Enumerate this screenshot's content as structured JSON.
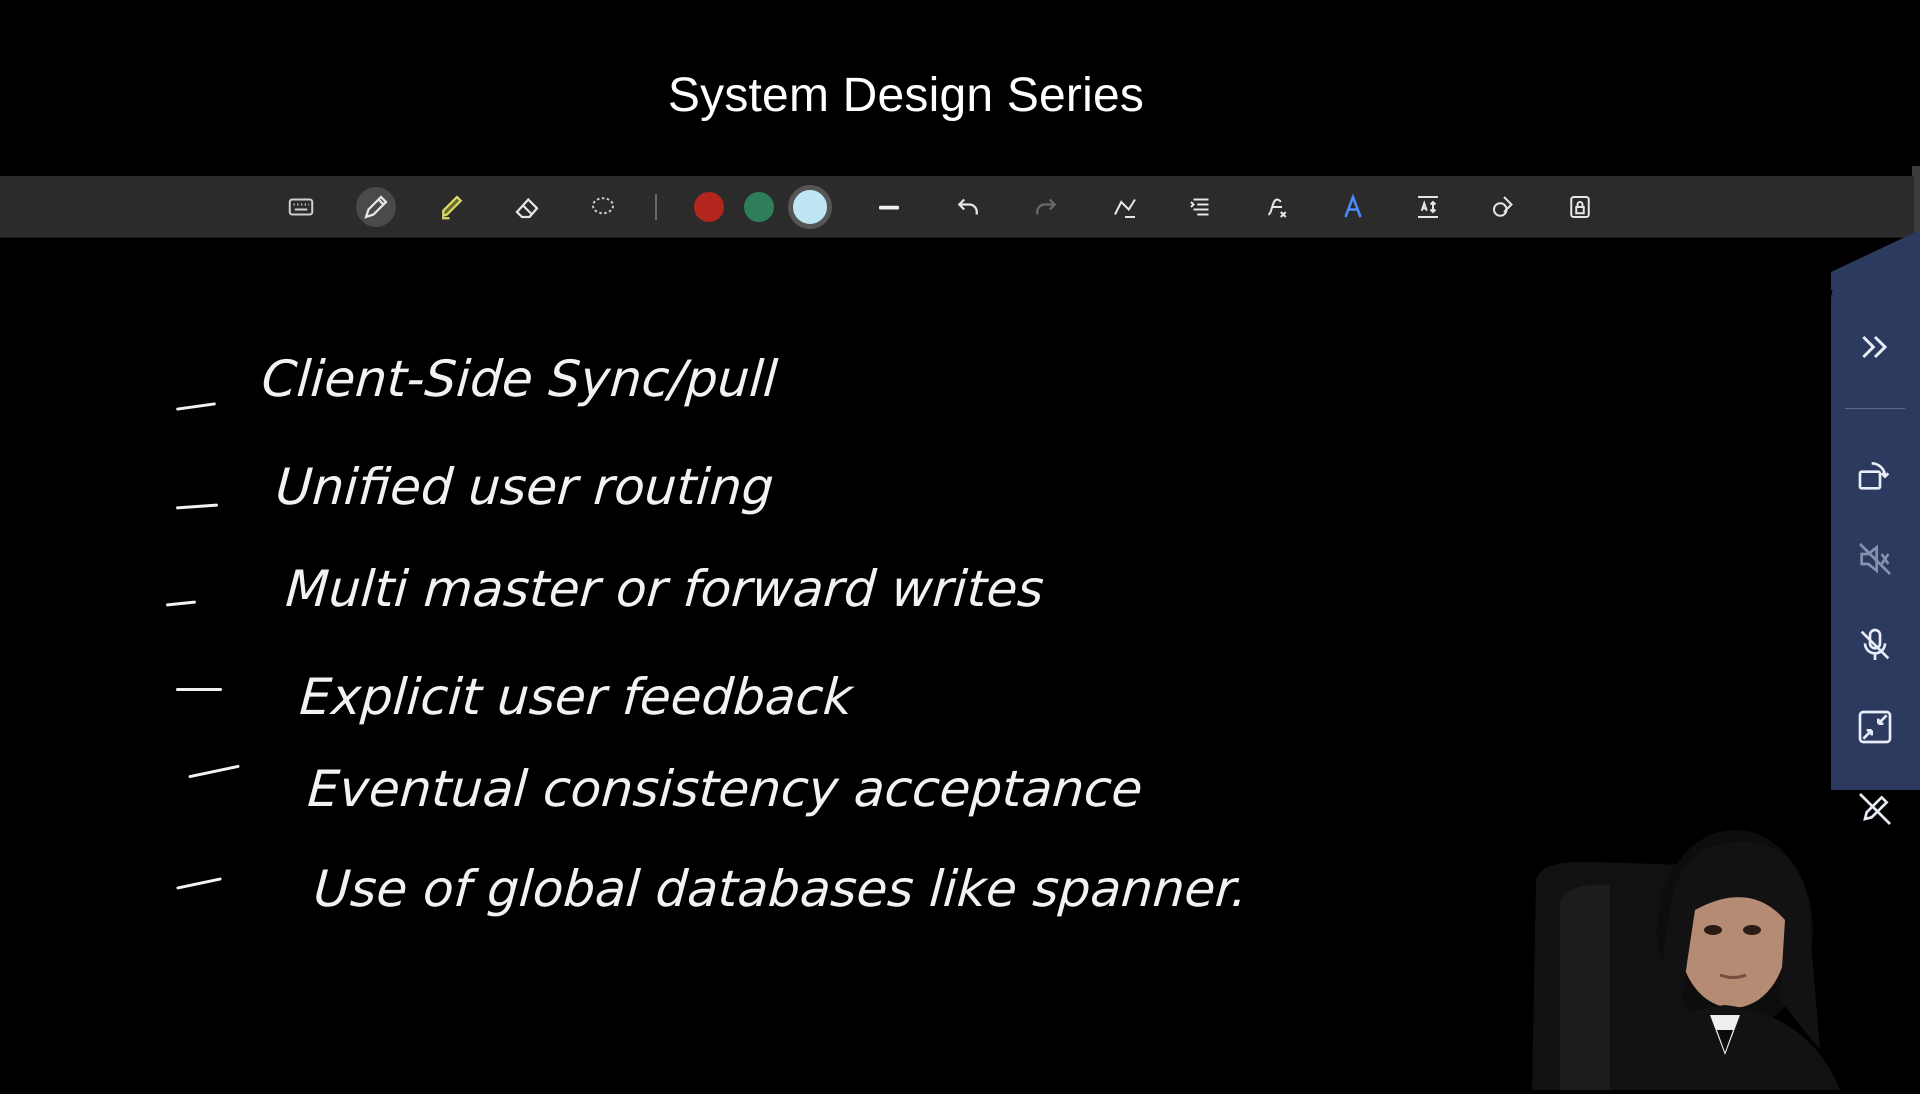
{
  "header": {
    "title": "System Design Series"
  },
  "toolbar": {
    "tools": [
      {
        "icon": "keyboard-icon"
      },
      {
        "icon": "pen-icon",
        "active": true
      },
      {
        "icon": "highlighter-icon"
      },
      {
        "icon": "eraser-icon"
      },
      {
        "icon": "lasso-select-icon"
      }
    ],
    "colors": [
      {
        "hex": "#b3261e"
      },
      {
        "hex": "#2e7d5b"
      },
      {
        "hex": "#bfe6f5",
        "selected": true
      }
    ],
    "actions": [
      {
        "icon": "stroke-width-icon"
      },
      {
        "icon": "undo-icon"
      },
      {
        "icon": "redo-icon",
        "disabled": true
      },
      {
        "icon": "ink-to-shape-icon"
      },
      {
        "icon": "ink-to-text-icon"
      },
      {
        "icon": "ink-to-math-icon"
      },
      {
        "icon": "ink-styling-icon"
      },
      {
        "icon": "insert-space-icon"
      },
      {
        "icon": "shapes-icon"
      },
      {
        "icon": "lock-icon"
      }
    ]
  },
  "board": {
    "ink_color": "#f2f2f2",
    "items": [
      "Client-Side Sync/pull",
      "Unified user routing",
      "Multi master or forward writes",
      "Explicit user feedback",
      "Eventual consistency acceptance",
      "Use of global databases like spanner."
    ]
  },
  "side_panel": {
    "color": "#2b3a5e",
    "buttons": [
      {
        "icon": "collapse-chevrons-icon"
      },
      {
        "icon": "rotate-screen-icon"
      },
      {
        "icon": "speaker-muted-icon"
      },
      {
        "icon": "mic-muted-icon"
      },
      {
        "icon": "minimize-window-icon"
      },
      {
        "icon": "pen-off-icon"
      }
    ]
  }
}
